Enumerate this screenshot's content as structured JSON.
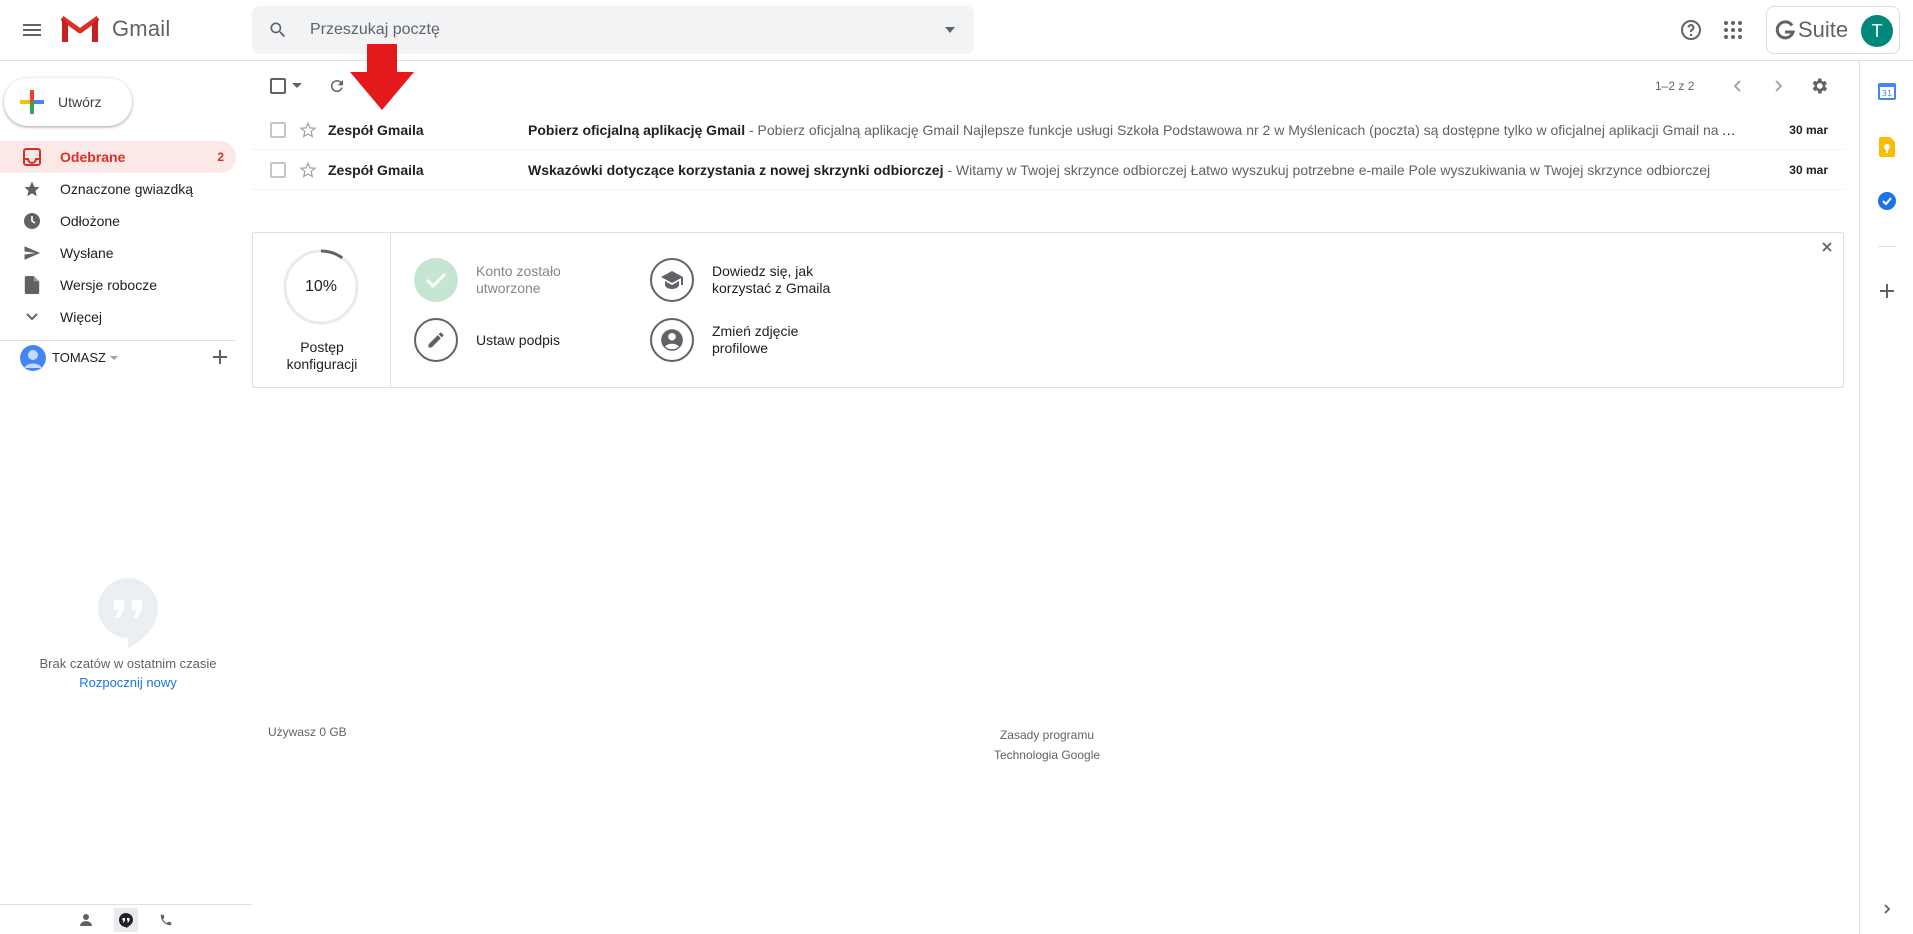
{
  "header": {
    "logo_text": "Gmail",
    "search_placeholder": "Przeszukaj pocztę",
    "gsuite_label": "Suite",
    "account_initial": "T"
  },
  "sidebar": {
    "compose_label": "Utwórz",
    "items": [
      {
        "label": "Odebrane",
        "count": "2",
        "icon": "inbox-icon"
      },
      {
        "label": "Oznaczone gwiazdką",
        "count": "",
        "icon": "star-icon"
      },
      {
        "label": "Odłożone",
        "count": "",
        "icon": "clock-icon"
      },
      {
        "label": "Wysłane",
        "count": "",
        "icon": "send-icon"
      },
      {
        "label": "Wersje robocze",
        "count": "",
        "icon": "draft-icon"
      },
      {
        "label": "Więcej",
        "count": "",
        "icon": "chevron-down-icon"
      }
    ],
    "user_name": "TOMASZ",
    "no_chats": "Brak czatów w ostatnim czasie",
    "start_new": "Rozpocznij nowy"
  },
  "toolbar": {
    "pagination": "1–2 z 2"
  },
  "emails": [
    {
      "sender": "Zespół Gmaila",
      "subject": "Pobierz oficjalną aplikację Gmail",
      "snippet": " - Pobierz oficjalną aplikację Gmail Najlepsze funkcje usługi Szkoła Podstawowa nr 2 w Myślenicach (poczta) są dostępne tylko w oficjalnej aplikacji Gmail na Androida i iOS",
      "date": "30 mar"
    },
    {
      "sender": "Zespół Gmaila",
      "subject": "Wskazówki dotyczące korzystania z nowej skrzynki odbiorczej",
      "snippet": " - Witamy w Twojej skrzynce odbiorczej Łatwo wyszukuj potrzebne e-maile Pole wyszukiwania w Twojej skrzynce odbiorczej",
      "date": "30 mar"
    }
  ],
  "setup": {
    "progress_value": 10,
    "progress_text": "10%",
    "progress_label_1": "Postęp",
    "progress_label_2": "konfiguracji",
    "items": [
      {
        "line1": "Konto zostało",
        "line2": "utworzone",
        "done": true
      },
      {
        "line1": "Dowiedz się, jak",
        "line2": "korzystać z Gmaila",
        "done": false
      },
      {
        "line1": "Ustaw podpis",
        "line2": "",
        "done": false
      },
      {
        "line1": "Zmień zdjęcie",
        "line2": "profilowe",
        "done": false
      }
    ]
  },
  "footer": {
    "storage": "Używasz 0 GB",
    "policies_1": "Zasady programu",
    "policies_2": "Technologia Google"
  },
  "colors": {
    "accent_red": "#d93025",
    "active_bg": "#fce8e6",
    "link_blue": "#1a73e8",
    "avatar_teal": "#00897b"
  }
}
